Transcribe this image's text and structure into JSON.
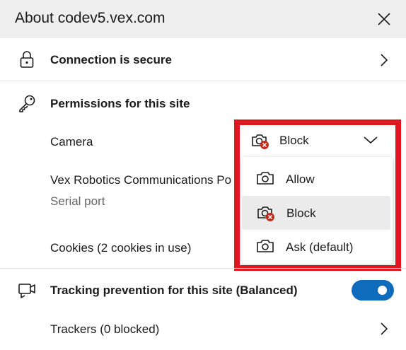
{
  "header": {
    "title": "About codev5.vex.com"
  },
  "connection": {
    "label": "Connection is secure"
  },
  "permissions": {
    "title": "Permissions for this site",
    "camera": {
      "label": "Camera",
      "value": "Block"
    },
    "vex": {
      "label": "Vex Robotics Communications Po",
      "sub": "Serial port"
    },
    "cookies": {
      "label": "Cookies (2 cookies in use)"
    }
  },
  "dropdown": {
    "options": [
      {
        "label": "Allow",
        "icon": "camera-icon"
      },
      {
        "label": "Block",
        "icon": "camera-blocked-icon",
        "selected": true
      },
      {
        "label": "Ask (default)",
        "icon": "camera-icon"
      }
    ]
  },
  "tracking": {
    "label": "Tracking prevention for this site (Balanced)",
    "toggle_on": true,
    "accent_color": "#0f6cbd",
    "trackers": {
      "label": "Trackers (0 blocked)"
    }
  },
  "highlight_color": "#e0171f"
}
